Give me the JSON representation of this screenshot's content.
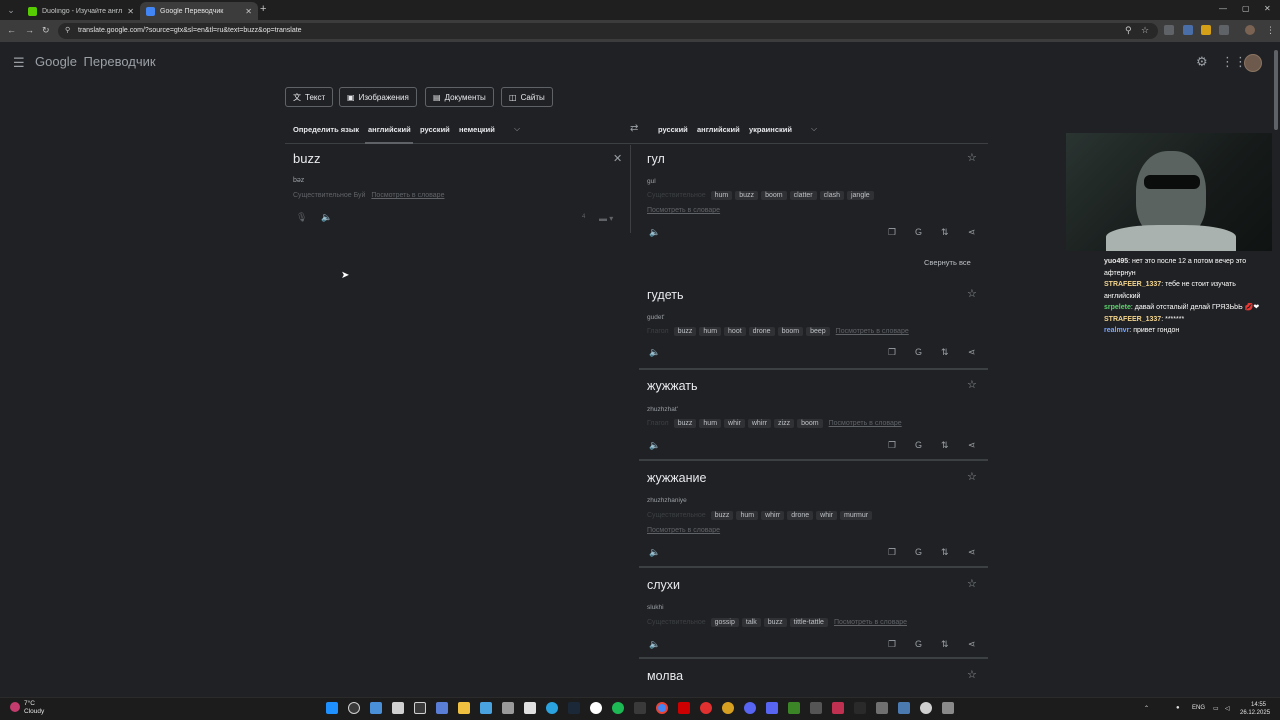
{
  "browser": {
    "tabs": [
      {
        "title": "Duolingo - Изучайте английск",
        "active": false
      },
      {
        "title": "Google Переводчик",
        "active": true
      }
    ],
    "url": "translate.google.com/?source=gtx&sl=en&tl=ru&text=buzz&op=translate"
  },
  "header": {
    "logo_google": "Google",
    "logo_product": "Переводчик"
  },
  "modes": [
    {
      "label": "Текст",
      "icon": "translate-icon"
    },
    {
      "label": "Изображения",
      "icon": "image-icon"
    },
    {
      "label": "Документы",
      "icon": "document-icon"
    },
    {
      "label": "Сайты",
      "icon": "website-icon"
    }
  ],
  "source_langs": [
    "Определить язык",
    "английский",
    "русский",
    "немецкий"
  ],
  "target_langs": [
    "русский",
    "английский",
    "украинский"
  ],
  "source": {
    "text": "buzz",
    "transliteration": "bəz",
    "definition": "Существительное Буй",
    "dict_link": "Посмотреть в словаре",
    "char_count": "4"
  },
  "collapse_all": "Свернуть все",
  "results": [
    {
      "word": "гул",
      "translit": "gul",
      "pos": "Существительное",
      "chips": [
        "hum",
        "buzz",
        "boom",
        "clatter",
        "clash",
        "jangle"
      ],
      "dict_link": "Посмотреть в словаре"
    },
    {
      "word": "гудеть",
      "translit": "gudet'",
      "pos": "Глагол",
      "chips": [
        "buzz",
        "hum",
        "hoot",
        "drone",
        "boom",
        "beep"
      ],
      "dict_link": "Посмотреть в словаре"
    },
    {
      "word": "жужжать",
      "translit": "zhuzhzhat'",
      "pos": "Глагол",
      "chips": [
        "buzz",
        "hum",
        "whir",
        "whirr",
        "zizz",
        "boom"
      ],
      "dict_link": "Посмотреть в словаре"
    },
    {
      "word": "жужжание",
      "translit": "zhuzhzhaniye",
      "pos": "Существительное",
      "chips": [
        "buzz",
        "hum",
        "whirr",
        "drone",
        "whir",
        "murmur"
      ],
      "dict_link": "Посмотреть в словаре"
    },
    {
      "word": "слухи",
      "translit": "slukhi",
      "pos": "Существительное",
      "chips": [
        "gossip",
        "talk",
        "buzz",
        "tittle-tattle"
      ],
      "dict_link": "Посмотреть в словаре"
    },
    {
      "word": "молва"
    }
  ],
  "chat": [
    {
      "user": "yuo495",
      "color": "#e6e6e6",
      "text": "нет это после 12 а потом вечер это афтернун"
    },
    {
      "user": "STRAFEER_1337",
      "color": "#f4d58d",
      "text": "тебе не стоит изучать английский"
    },
    {
      "user": "srpelete",
      "color": "#5bd66b",
      "text": "давай отсталый! делай ГРЯЗЬbЬ 💋❤"
    },
    {
      "user": "STRAFEER_1337",
      "color": "#f4d58d",
      "text": "*******"
    },
    {
      "user": "realmvr",
      "color": "#7aa7ff",
      "text": "привет гондон"
    }
  ],
  "taskbar": {
    "weather_temp": "7°C",
    "weather_desc": "Cloudy",
    "lang": "ENG",
    "time": "14:55",
    "date": "26.12.2025"
  }
}
